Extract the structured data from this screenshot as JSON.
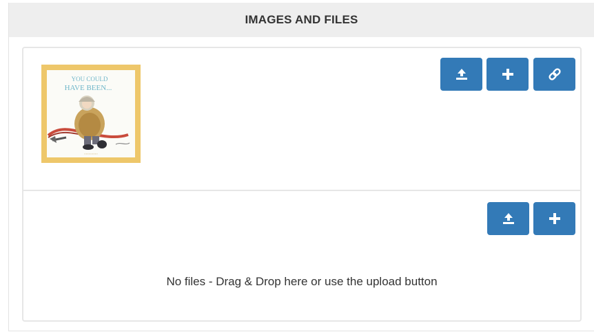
{
  "panel": {
    "title": "IMAGES AND FILES"
  },
  "images_section": {
    "buttons": [
      {
        "icon": "upload-icon"
      },
      {
        "icon": "plus-icon"
      },
      {
        "icon": "link-icon"
      }
    ],
    "thumbnail": {
      "cover_title_line1": "YOU COULD",
      "cover_title_line2": "HAVE BEEN..."
    }
  },
  "files_section": {
    "buttons": [
      {
        "icon": "upload-icon"
      },
      {
        "icon": "plus-icon"
      }
    ],
    "empty_message": "No files - Drag & Drop here or use the upload button"
  },
  "colors": {
    "button": "#337ab7",
    "header_bg": "#eeeeee",
    "thumb_frame": "#eec76a"
  }
}
